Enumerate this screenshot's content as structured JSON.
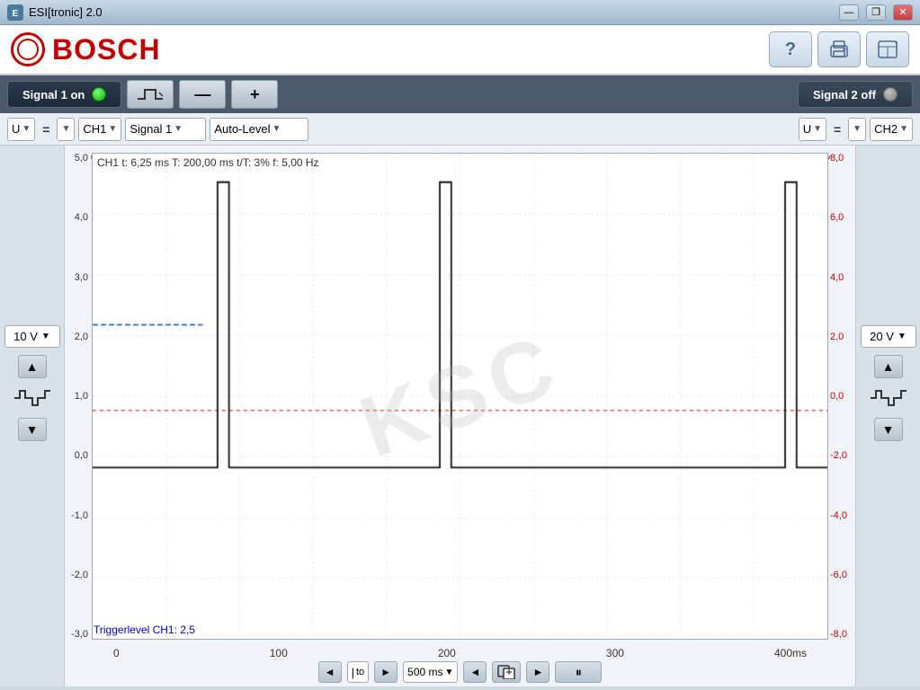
{
  "app": {
    "title": "ESI[tronic] 2.0"
  },
  "titlebar": {
    "title": "ESI[tronic] 2.0",
    "minimize_label": "—",
    "maximize_label": "❐",
    "close_label": "✕"
  },
  "header": {
    "brand": "BOSCH",
    "help_icon": "?",
    "print_icon": "🖨",
    "layout_icon": "⊞"
  },
  "signal_bar": {
    "signal1_label": "Signal 1 on",
    "signal2_label": "Signal 2 off",
    "trigger_icon": "⤵",
    "minus_label": "—",
    "plus_label": "+"
  },
  "ch_row": {
    "left": {
      "unit": "U",
      "eq": "=",
      "ch": "CH1",
      "signal": "Signal 1",
      "level": "Auto-Level"
    },
    "right": {
      "unit": "U",
      "eq": "=",
      "ch": "CH2"
    }
  },
  "left_ctrl": {
    "volt_label": "10 V",
    "arrow_up": "▲",
    "arrow_down": "▼"
  },
  "right_ctrl": {
    "volt_label": "20 V",
    "arrow_up": "▲",
    "arrow_down": "▼"
  },
  "chart": {
    "info": "CH1  t: 6,25 ms   T: 200,00 ms   t/T: 3%   f: 5,00 Hz",
    "trigger_label": "Triggerlevel CH1: 2,5",
    "watermark": "KSC",
    "y_axis_left": [
      "5,0",
      "4,0",
      "3,0",
      "2,0",
      "1,0",
      "0,0",
      "-1,0",
      "-2,0",
      "-3,0"
    ],
    "y_axis_right": [
      "8,0",
      "6,0",
      "4,0",
      "2,0",
      "0,0",
      "-2,0",
      "-4,0",
      "-6,0",
      "-8,0"
    ],
    "y_unit_left": "V",
    "y_unit_right": "V",
    "x_axis": [
      "0",
      "100",
      "200",
      "300",
      "400ms"
    ],
    "trigger_level_y": 2.5,
    "y_max": 6.0,
    "y_min": -3.5
  },
  "bottom": {
    "nav_left": "◄",
    "nav_right": "►",
    "to_label": "to",
    "time_label": "500 ms",
    "copy_left": "◄",
    "copy_right": "►",
    "pause_label": "⏸",
    "time_arrow": "▼"
  }
}
